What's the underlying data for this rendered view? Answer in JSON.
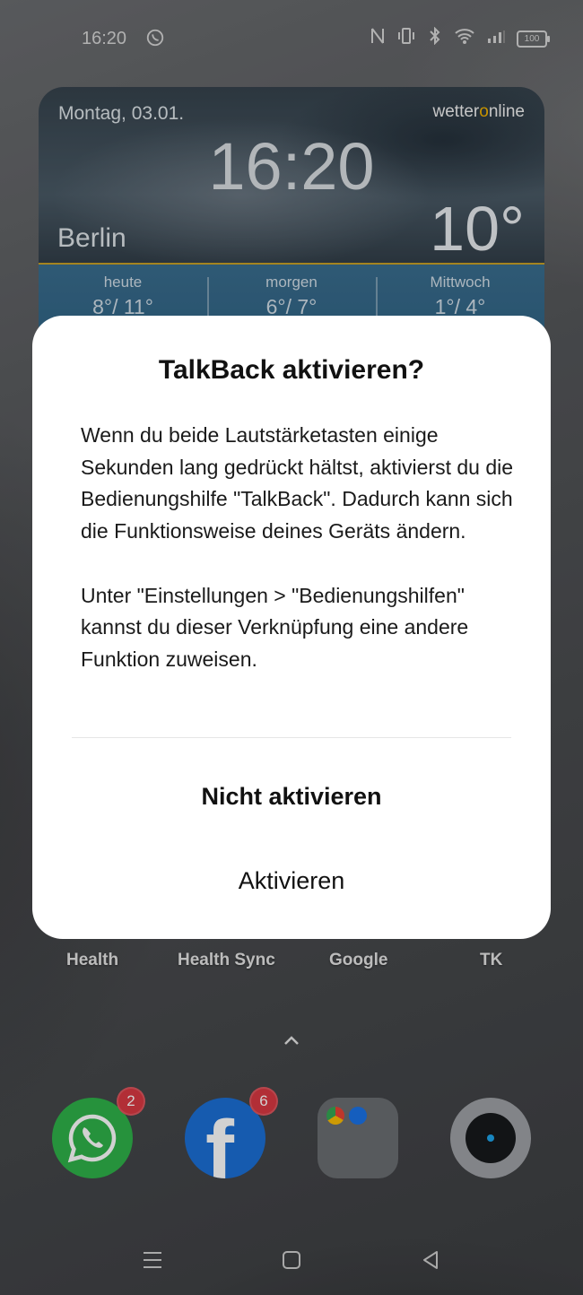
{
  "status_bar": {
    "time": "16:20",
    "battery": "100"
  },
  "weather_widget": {
    "date": "Montag, 03.01.",
    "brand_prefix": "wetter",
    "brand_o": "o",
    "brand_suffix": "nline",
    "time": "16:20",
    "city": "Berlin",
    "temperature": "10°",
    "forecast": [
      {
        "day": "heute",
        "range": "8°/ 11°"
      },
      {
        "day": "morgen",
        "range": "6°/ 7°"
      },
      {
        "day": "Mittwoch",
        "range": "1°/ 4°"
      }
    ]
  },
  "apps": [
    {
      "label": "Health"
    },
    {
      "label": "Health Sync"
    },
    {
      "label": "Google"
    },
    {
      "label": "TK"
    }
  ],
  "dock": {
    "whatsapp_badge": "2",
    "facebook_badge": "6",
    "facebook_letter": "f"
  },
  "dialog": {
    "title": "TalkBack aktivieren?",
    "message": "Wenn du beide Lautstärketasten einige Sekunden lang gedrückt hältst, aktivierst du die Bedienungshilfe \"TalkBack\". Dadurch kann sich die Funktionsweise deines Geräts ändern.\n\nUnter \"Einstellungen > \"Bedienungshilfen\" kannst du dieser Verknüpfung eine andere Funktion zuweisen.",
    "negative_button": "Nicht aktivieren",
    "positive_button": "Aktivieren"
  },
  "colors": {
    "whatsapp": "#2fb34a",
    "facebook": "#1c6fd6",
    "badge": "#d93942",
    "brand_accent": "#f4b400"
  }
}
